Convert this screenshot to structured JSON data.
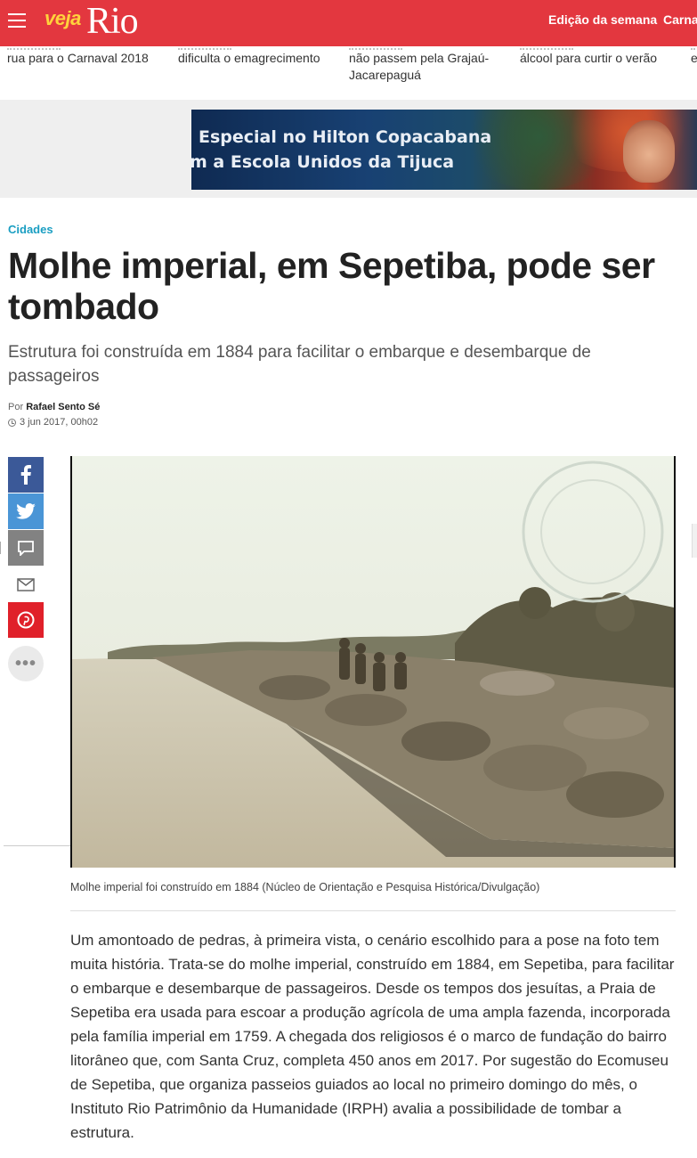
{
  "header": {
    "logo_veja": "veja",
    "logo_rio": "Rio",
    "nav": [
      "Edição da semana",
      "Carna"
    ]
  },
  "related": [
    "rua para o Carnaval 2018",
    "dificulta o emagrecimento",
    "não passem pela Grajaú-Jacarepaguá",
    "álcool para curtir o verão",
    "e B"
  ],
  "ad": {
    "line1": "Especial no Hilton Copacabana",
    "line2": "m a Escola Unidos da Tijuca"
  },
  "article": {
    "section": "Cidades",
    "headline": "Molhe imperial, em Sepetiba, pode ser tombado",
    "subtitle": "Estrutura foi construída em 1884 para facilitar o embarque e desembarque de passageiros",
    "byline_prefix": "Por",
    "author": "Rafael Sento Sé",
    "date": "3 jun 2017, 00h02",
    "caption": "Molhe imperial foi construído em 1884 (Núcleo de Orientação e Pesquisa Histórica/Divulgação)",
    "body": "Um amontoado de pedras, à primeira vista, o cenário escolhido para a pose na foto tem muita história. Trata-se do molhe imperial, construído em 1884, em Sepetiba, para facilitar o embarque e desembarque de passageiros. Desde os tempos dos jesuítas, a Praia de Sepetiba era usada para escoar a produção agrícola de uma ampla fazenda, incorporada pela família imperial em 1759. A chegada dos religiosos é o marco de fundação do bairro litorâneo que, com Santa Cruz, completa 450 anos em 2017. Por sugestão do Ecomuseu de Sepetiba, que organiza passeios guiados ao local no primeiro domingo do mês, o Instituto Rio Patrimônio da Humanidade (IRPH) avalia a possibilidade de tombar a estrutura."
  },
  "share_icons": [
    "facebook-icon",
    "twitter-icon",
    "comment-icon",
    "email-icon",
    "pinterest-icon",
    "more-icon"
  ],
  "colors": {
    "header_bg": "#e3373f",
    "logo_veja": "#ffd23c",
    "section": "#1a9ec2",
    "facebook": "#3b5998",
    "twitter": "#4a95d6",
    "comment": "#828282",
    "pinterest": "#e0202a"
  }
}
